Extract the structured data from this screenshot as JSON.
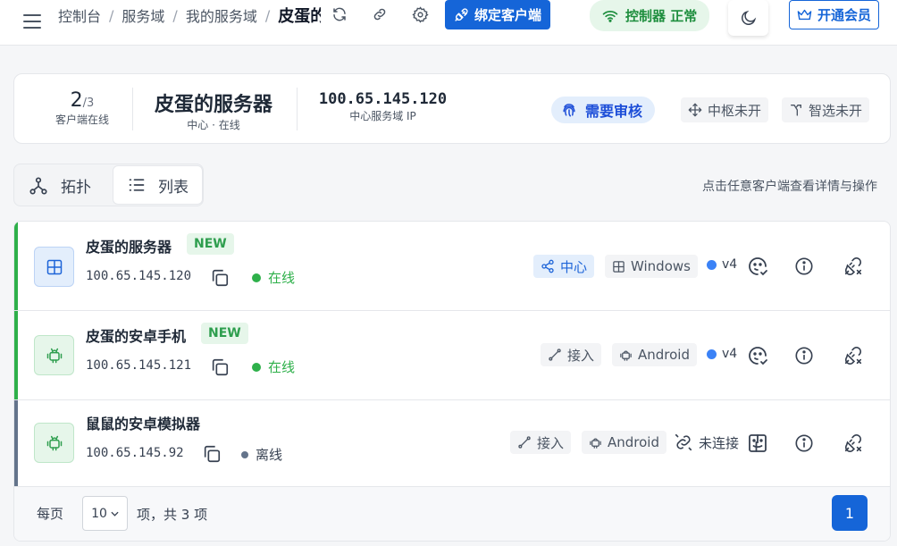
{
  "breadcrumb": [
    "控制台",
    "服务域",
    "我的服务域",
    "皮蛋的服务器"
  ],
  "topbar": {
    "bind_label": "绑定客户端",
    "status_label": "控制器 正常",
    "vip_label": "开通会员"
  },
  "summary": {
    "online_count": "2",
    "online_total": "/3",
    "online_label": "客户端在线",
    "server_name": "皮蛋的服务器",
    "server_sub": "中心 · 在线",
    "ip": "100.65.145.120",
    "ip_label": "中心服务域 IP",
    "review_label": "需要审核",
    "hub_label": "中枢未开",
    "smart_label": "智选未开"
  },
  "tabs": [
    {
      "label": "拓扑",
      "icon": "topology-icon"
    },
    {
      "label": "列表",
      "icon": "list-icon"
    }
  ],
  "hint": "点击任意客户端查看详情与操作",
  "clients": [
    {
      "name": "皮蛋的服务器",
      "badge": "NEW",
      "ip": "100.65.145.120",
      "status": "在线",
      "role": "中心",
      "os": "Windows",
      "version": "v4",
      "accent": "#2eb04a"
    },
    {
      "name": "皮蛋的安卓手机",
      "badge": "NEW",
      "ip": "100.65.145.121",
      "status": "在线",
      "role": "接入",
      "os": "Android",
      "version": "v4",
      "accent": "#2eb04a"
    },
    {
      "name": "鼠鼠的安卓模拟器",
      "badge": "",
      "ip": "100.65.145.92",
      "status": "离线",
      "role": "接入",
      "os": "Android",
      "version": "未连接",
      "accent": "#64748b"
    }
  ],
  "pagination": {
    "per_page_label": "每页",
    "per_page_value": "10",
    "total_text": "项，共 3 项",
    "current_page": "1"
  },
  "colors": {
    "primary": "#1565d8",
    "online": "#2eb04a",
    "offline": "#64748b"
  }
}
